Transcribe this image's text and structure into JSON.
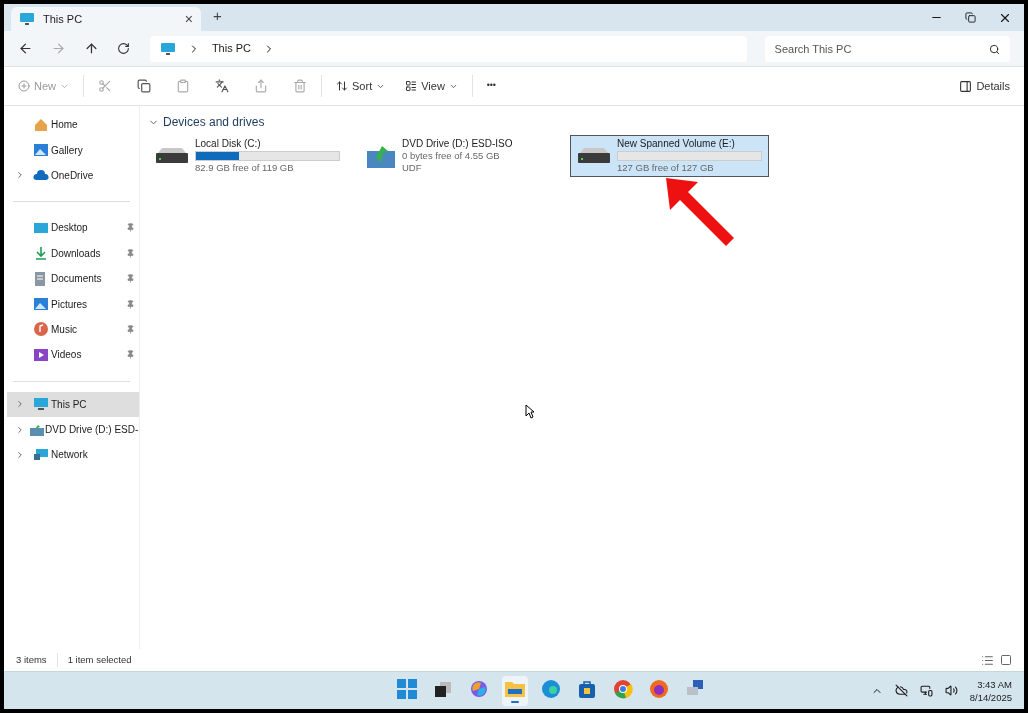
{
  "tab": {
    "title": "This PC",
    "close": "×",
    "new_tab": "+"
  },
  "address": {
    "path": [
      "This PC"
    ]
  },
  "search": {
    "placeholder": "Search This PC"
  },
  "toolbar": {
    "new": "New",
    "sort": "Sort",
    "view": "View",
    "more": "•••",
    "details": "Details"
  },
  "sidebar": {
    "groups": [
      [
        {
          "label": "Home",
          "expandable": false,
          "pinned": false,
          "selected": false
        },
        {
          "label": "Gallery",
          "expandable": false,
          "pinned": false,
          "selected": false
        },
        {
          "label": "OneDrive",
          "expandable": true,
          "pinned": false,
          "selected": false
        }
      ],
      [
        {
          "label": "Desktop",
          "expandable": false,
          "pinned": true,
          "selected": false
        },
        {
          "label": "Downloads",
          "expandable": false,
          "pinned": true,
          "selected": false
        },
        {
          "label": "Documents",
          "expandable": false,
          "pinned": true,
          "selected": false
        },
        {
          "label": "Pictures",
          "expandable": false,
          "pinned": true,
          "selected": false
        },
        {
          "label": "Music",
          "expandable": false,
          "pinned": true,
          "selected": false
        },
        {
          "label": "Videos",
          "expandable": false,
          "pinned": true,
          "selected": false
        }
      ],
      [
        {
          "label": "This PC",
          "expandable": true,
          "pinned": false,
          "selected": true
        },
        {
          "label": "DVD Drive (D:) ESD-",
          "expandable": true,
          "pinned": false,
          "selected": false
        },
        {
          "label": "Network",
          "expandable": true,
          "pinned": false,
          "selected": false
        }
      ]
    ]
  },
  "section": {
    "title": "Devices and drives",
    "expanded": true
  },
  "drives": [
    {
      "kind": "disk",
      "name": "Local Disk (C:)",
      "level": 0.3,
      "info": [
        "82.9 GB free of 119 GB"
      ],
      "selected": false
    },
    {
      "kind": "optical",
      "name": "DVD Drive (D:) ESD-ISO",
      "info": [
        "0 bytes free of 4.55 GB",
        "UDF"
      ],
      "selected": false
    },
    {
      "kind": "disk",
      "name": "New Spanned Volume (E:)",
      "level": 0,
      "info": [
        "127 GB free of 127 GB"
      ],
      "selected": true
    }
  ],
  "status_bar": {
    "items": "3 items",
    "selection": "1 item selected"
  },
  "taskbar": {
    "apps": [
      {
        "active": false
      },
      {
        "active": false
      },
      {
        "active": false
      },
      {
        "active": true
      },
      {
        "active": false
      },
      {
        "active": false
      },
      {
        "active": false
      },
      {
        "active": false
      },
      {
        "active": false
      }
    ],
    "time": "3:43 AM",
    "date": "8/14/2025"
  }
}
